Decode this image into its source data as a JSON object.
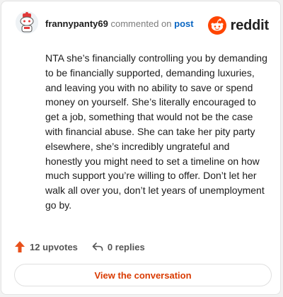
{
  "comment": {
    "username": "frannypanty69",
    "action_text": "commented on",
    "post_link": "post",
    "body": "NTA she’s financially controlling you by demanding to be financially supported, demanding luxuries, and leaving you with no ability to save or spend money on yourself. She’s literally encouraged to get a job, something that would not be the case with financial abuse. She can take her pity party elsewhere, she’s incredibly ungrateful and honestly you might need to set a timeline on how much support you’re willing to offer. Don’t let her walk all over you, don’t let years of unemployment go by."
  },
  "brand": {
    "name": "reddit",
    "icon": "reddit-logo-icon",
    "color": "#ff4500"
  },
  "stats": {
    "upvotes": "12 upvotes",
    "upvote_icon": "upvote-arrow-icon",
    "replies": "0 replies",
    "reply_icon": "reply-arrow-icon"
  },
  "cta": {
    "label": "View the conversation"
  },
  "colors": {
    "accent": "#d93a00",
    "link": "#0a66c2",
    "upvote": "#e8501b"
  }
}
